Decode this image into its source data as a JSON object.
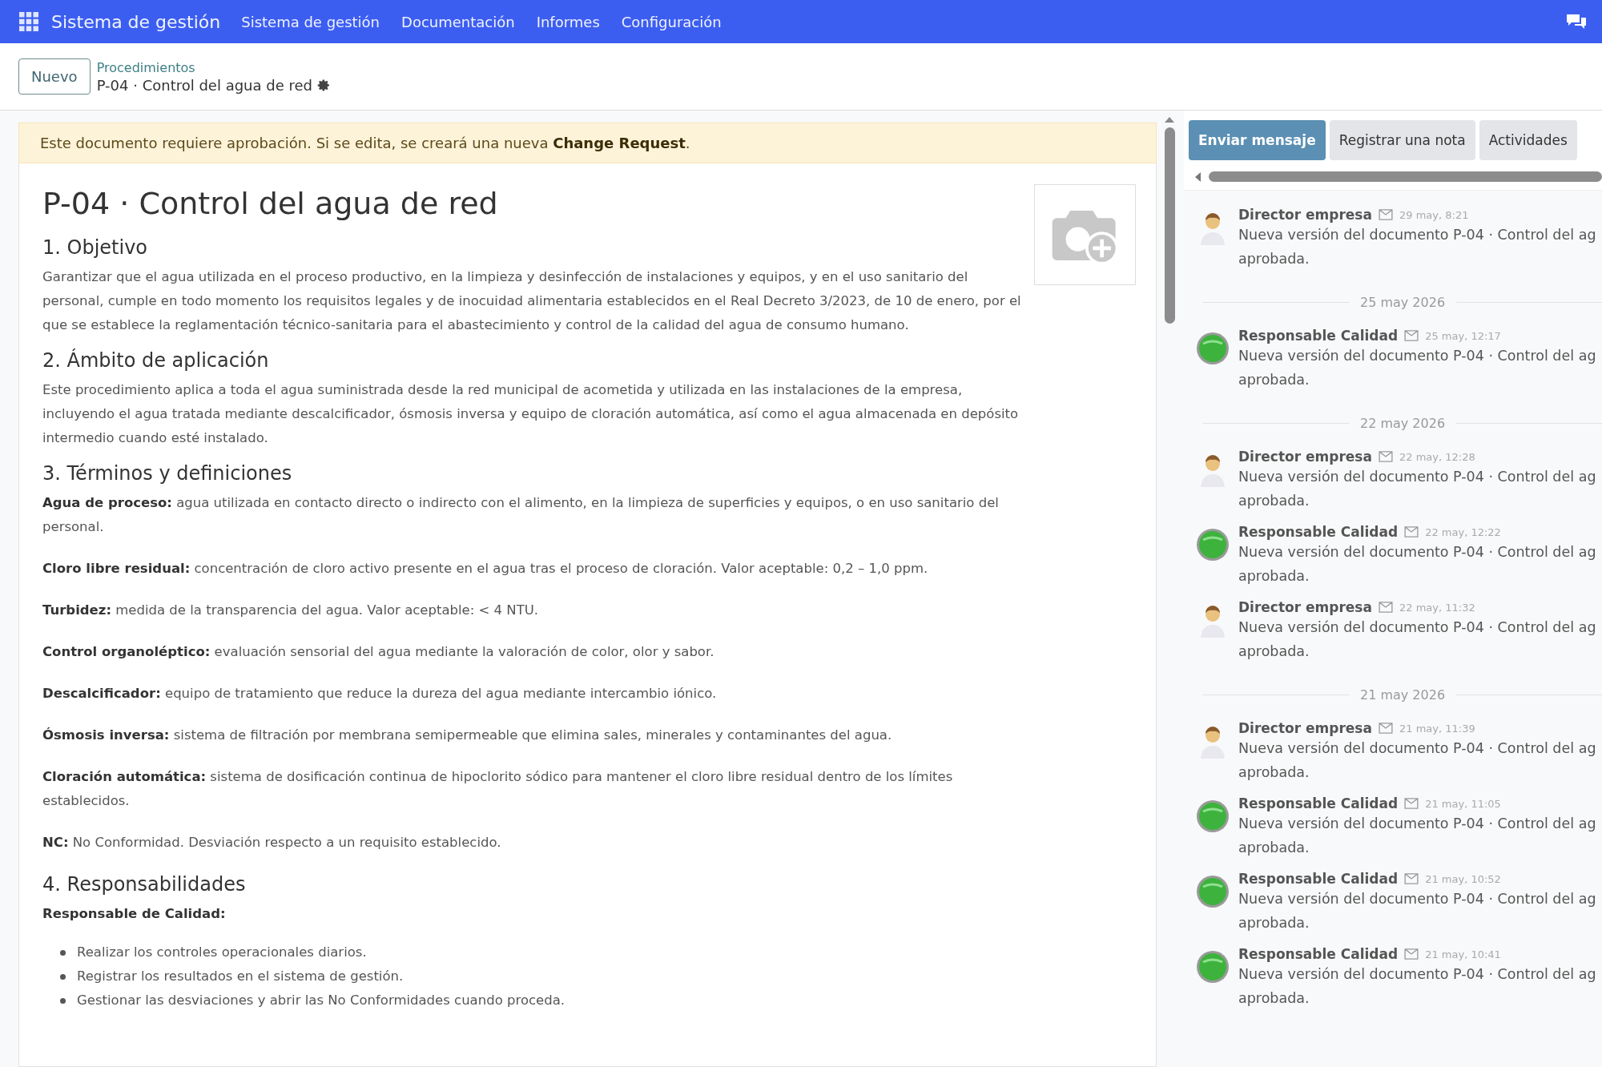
{
  "navbar": {
    "app_title": "Sistema de gestión",
    "menu": [
      "Sistema de gestión",
      "Documentación",
      "Informes",
      "Configuración"
    ]
  },
  "control_panel": {
    "new_button": "Nuevo",
    "breadcrumb_parent": "Procedimientos",
    "breadcrumb_current": "P-04 · Control del agua de red"
  },
  "alert": "Este documento requiere aprobación. Si se edita, se creará una nueva **Change Request**.",
  "document": {
    "title": "P-04 · Control del agua de red",
    "sections": [
      {
        "heading": "1. Objetivo",
        "blocks": [
          {
            "kind": "paragraph",
            "text": "Garantizar que el agua utilizada en el proceso productivo, en la limpieza y desinfección de instalaciones y equipos, y en el uso sanitario del personal, cumple en todo momento los requisitos legales y de inocuidad alimentaria establecidos en el Real Decreto 3/2023, de 10 de enero, por el que se establece la reglamentación técnico-sanitaria para el abastecimiento y control de la calidad del agua de consumo humano."
          }
        ]
      },
      {
        "heading": "2. Ámbito de aplicación",
        "blocks": [
          {
            "kind": "paragraph",
            "text": "Este procedimiento aplica a toda el agua suministrada desde la red municipal de acometida y utilizada en las instalaciones de la empresa, incluyendo el agua tratada mediante descalcificador, ósmosis inversa y equipo de cloración automática, así como el agua almacenada en depósito intermedio cuando esté instalado."
          }
        ]
      },
      {
        "heading": "3. Términos y definiciones",
        "blocks": [
          {
            "kind": "definition",
            "text": "**Agua de proceso:** agua utilizada en contacto directo o indirecto con el alimento, en la limpieza de superficies y equipos, o en uso sanitario del personal."
          },
          {
            "kind": "definition",
            "text": "**Cloro libre residual:** concentración de cloro activo presente en el agua tras el proceso de cloración. Valor aceptable: 0,2 – 1,0 ppm."
          },
          {
            "kind": "definition",
            "text": "**Turbidez:** medida de la transparencia del agua. Valor aceptable: < 4 NTU."
          },
          {
            "kind": "definition",
            "text": "**Control organoléptico:** evaluación sensorial del agua mediante la valoración de color, olor y sabor."
          },
          {
            "kind": "definition",
            "text": "**Descalcificador:** equipo de tratamiento que reduce la dureza del agua mediante intercambio iónico."
          },
          {
            "kind": "definition",
            "text": "**Ósmosis inversa:** sistema de filtración por membrana semipermeable que elimina sales, minerales y contaminantes del agua."
          },
          {
            "kind": "definition",
            "text": "**Cloración automática:** sistema de dosificación continua de hipoclorito sódico para mantener el cloro libre residual dentro de los límites establecidos."
          },
          {
            "kind": "definition",
            "text": "**NC:** No Conformidad. Desviación respecto a un requisito establecido."
          }
        ]
      },
      {
        "heading": "4. Responsabilidades",
        "blocks": [
          {
            "kind": "subheading",
            "text": "Responsable de Calidad:"
          },
          {
            "kind": "bullets",
            "items": [
              "Realizar los controles operacionales diarios.",
              "Registrar los resultados en el sistema de gestión.",
              "Gestionar las desviaciones y abrir las No Conformidades cuando proceda."
            ]
          }
        ]
      }
    ]
  },
  "chatter": {
    "buttons": [
      {
        "label": "Enviar mensaje",
        "selected": true
      },
      {
        "label": "Registrar una nota",
        "selected": false
      },
      {
        "label": "Actividades",
        "selected": false
      }
    ],
    "entries": [
      {
        "kind": "person_message",
        "author": "Director empresa",
        "date": "29 may, 8:21",
        "lines": [
          "Nueva versión del documento P-04 · Control del ag",
          "aprobada."
        ]
      },
      {
        "kind": "separator",
        "date": "25 may 2026"
      },
      {
        "kind": "badge_message",
        "author": "Responsable Calidad",
        "date": "25 may, 12:17",
        "lines": [
          "Nueva versión del documento P-04 · Control del ag",
          "aprobada."
        ]
      },
      {
        "kind": "separator",
        "date": "22 may 2026"
      },
      {
        "kind": "person_message",
        "author": "Director empresa",
        "date": "22 may, 12:28",
        "lines": [
          "Nueva versión del documento P-04 · Control del ag",
          "aprobada."
        ]
      },
      {
        "kind": "badge_message",
        "author": "Responsable Calidad",
        "date": "22 may, 12:22",
        "lines": [
          "Nueva versión del documento P-04 · Control del ag",
          "aprobada."
        ]
      },
      {
        "kind": "person_message",
        "author": "Director empresa",
        "date": "22 may, 11:32",
        "lines": [
          "Nueva versión del documento P-04 · Control del ag",
          "aprobada."
        ]
      },
      {
        "kind": "separator",
        "date": "21 may 2026"
      },
      {
        "kind": "person_message",
        "author": "Director empresa",
        "date": "21 may, 11:39",
        "lines": [
          "Nueva versión del documento P-04 · Control del ag",
          "aprobada."
        ]
      },
      {
        "kind": "badge_message",
        "author": "Responsable Calidad",
        "date": "21 may, 11:05",
        "lines": [
          "Nueva versión del documento P-04 · Control del ag",
          "aprobada."
        ]
      },
      {
        "kind": "badge_message",
        "author": "Responsable Calidad",
        "date": "21 may, 10:52",
        "lines": [
          "Nueva versión del documento P-04 · Control del ag",
          "aprobada."
        ]
      },
      {
        "kind": "badge_message",
        "author": "Responsable Calidad",
        "date": "21 may, 10:41",
        "lines": [
          "Nueva versión del documento P-04 · Control del ag",
          "aprobada."
        ]
      }
    ]
  }
}
